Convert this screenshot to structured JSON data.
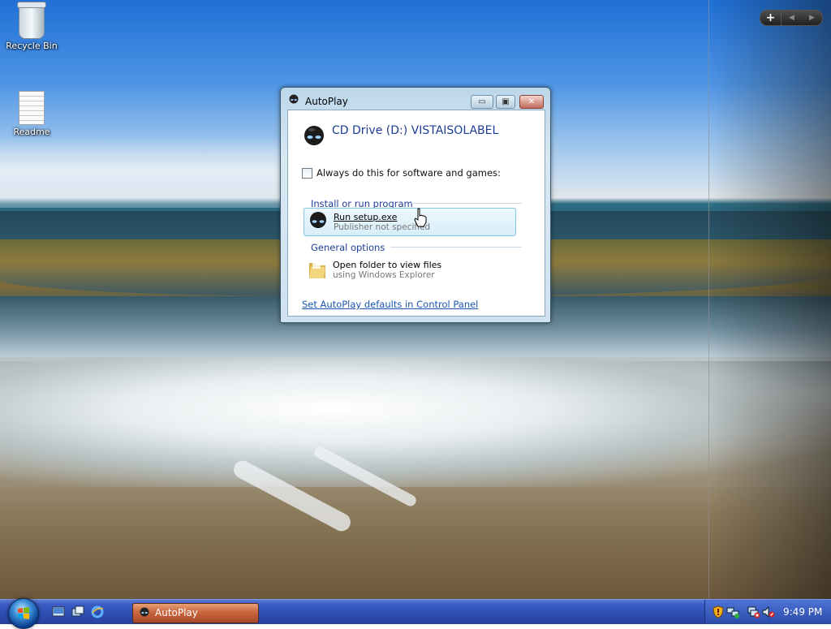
{
  "desktop": {
    "icons": [
      {
        "label": "Recycle Bin",
        "icon": "recycle-bin-icon"
      },
      {
        "label": "Readme",
        "icon": "text-document-icon"
      }
    ],
    "sidebar_control": {
      "add": "+",
      "prev": "◀",
      "next": "▶"
    }
  },
  "autoplay": {
    "title": "AutoPlay",
    "drive_title": "CD Drive (D:) VISTAISOLABEL",
    "always_label": "Always do this for software and games:",
    "always_checked": false,
    "sections": [
      {
        "heading": "Install or run program",
        "options": [
          {
            "main": "Run setup.exe",
            "sub": "Publisher not specified",
            "icon": "alien-head-icon",
            "hot": true
          }
        ]
      },
      {
        "heading": "General options",
        "options": [
          {
            "main": "Open folder to view files",
            "sub": "using Windows Explorer",
            "icon": "folder-icon",
            "hot": false
          }
        ]
      }
    ],
    "control_panel_link": "Set AutoPlay defaults in Control Panel"
  },
  "taskbar": {
    "active_task": "AutoPlay",
    "quick_launch": [
      "show-desktop-icon",
      "switch-windows-icon",
      "internet-explorer-icon"
    ],
    "tray_icons": [
      "security-shield-icon",
      "network-icon",
      "network-error-icon",
      "volume-muted-icon"
    ],
    "clock": "9:49 PM"
  },
  "colors": {
    "link": "#1b56b5",
    "heading": "#1e3e96",
    "taskbar": "#2d4db2",
    "active_task": "#c8663e"
  }
}
